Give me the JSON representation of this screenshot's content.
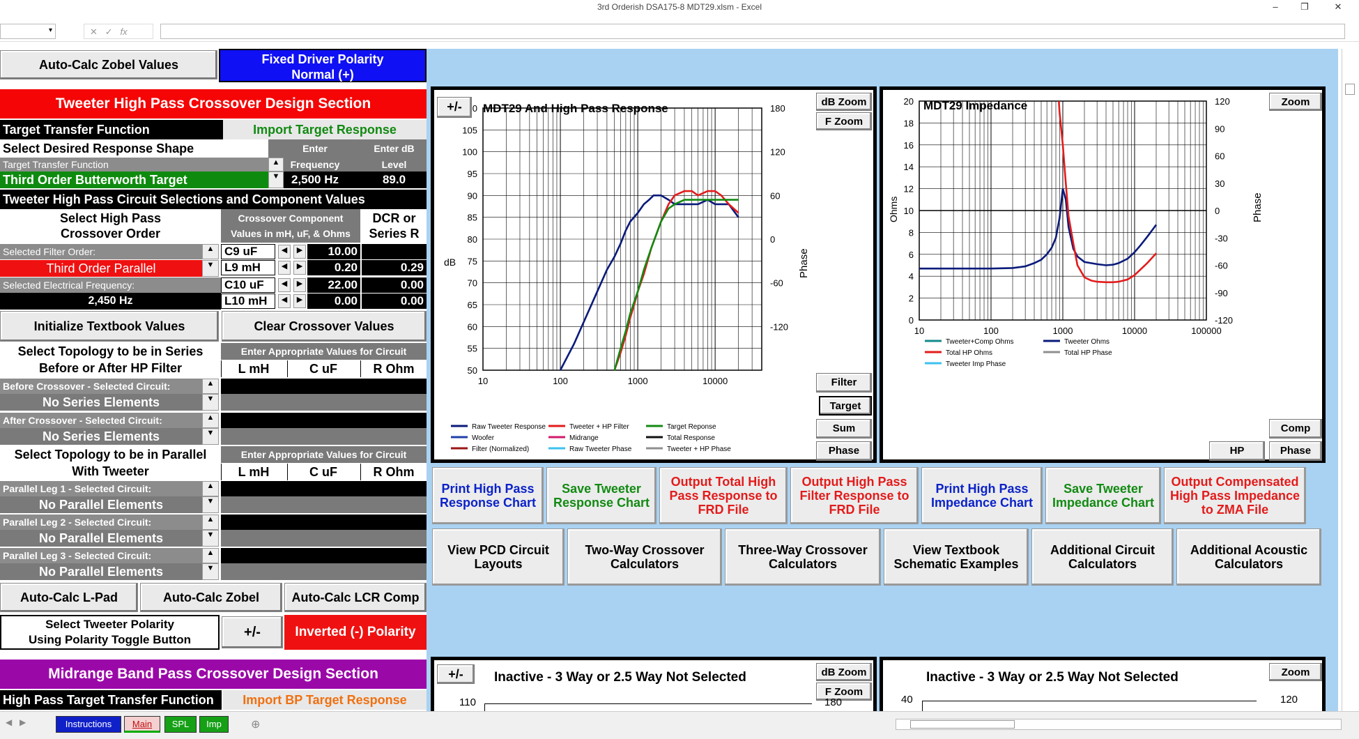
{
  "window": {
    "title": "3rd Orderish DSA175-8 MDT29.xlsm - Excel",
    "minimize": "–",
    "restore": "❐",
    "close": "✕"
  },
  "formula_bar": {
    "cancel": "✕",
    "enter": "✓",
    "fx": "fx"
  },
  "top_buttons": {
    "zobel": "Auto-Calc Zobel Values",
    "polarity_line1": "Fixed Driver Polarity",
    "polarity_line2": "Normal (+)"
  },
  "tweeter": {
    "section_title": "Tweeter High Pass Crossover Design Section",
    "target_tf_label": "Target Transfer Function",
    "import_target": "Import Target Response",
    "select_shape": "Select Desired Response Shape",
    "enter_freq_1": "Enter",
    "enter_freq_2": "Frequency",
    "enter_db_1": "Enter dB",
    "enter_db_2": "Level",
    "tf_small": "Target Transfer Function",
    "tf_value": "Third Order Butterworth Target",
    "freq_value": "2,500 Hz",
    "db_value": "89.0",
    "circuit_sel": "Tweeter High Pass Circuit Selections and Component Values",
    "select_order_1": "Select High Pass",
    "select_order_2": "Crossover Order",
    "comp_vals_1": "Crossover Component",
    "comp_vals_2": "Values in mH, uF, & Ohms",
    "dcr_1": "DCR or",
    "dcr_2": "Series R",
    "sel_filter_order": "Selected Filter Order:",
    "filter_order_value": "Third Order Parallel",
    "sel_elec_freq": "Selected Electrical Frequency:",
    "elec_freq_value": "2,450 Hz",
    "components": [
      {
        "name": "C9  uF",
        "value": "10.00",
        "dcr": ""
      },
      {
        "name": "L9 mH",
        "value": "0.20",
        "dcr": "0.29"
      },
      {
        "name": "C10  uF",
        "value": "22.00",
        "dcr": "0.00"
      },
      {
        "name": "L10 mH",
        "value": "0.00",
        "dcr": "0.00"
      }
    ],
    "init_textbook": "Initialize Textbook Values",
    "clear_values": "Clear Crossover Values",
    "series_title_1": "Select Topology to be in Series",
    "series_title_2": "Before or After HP Filter",
    "enter_vals": "Enter Appropriate Values for Circuit",
    "col_l": "L mH",
    "col_c": "C uF",
    "col_r": "R Ohm",
    "before_label": "Before Crossover - Selected Circuit:",
    "before_value": "No Series Elements",
    "after_label": "After Crossover - Selected Circuit:",
    "after_value": "No Series Elements",
    "parallel_title_1": "Select Topology to be in Parallel",
    "parallel_title_2": "With Tweeter",
    "legs": [
      {
        "label": "Parallel Leg 1 - Selected Circuit:",
        "value": "No Parallel Elements"
      },
      {
        "label": "Parallel Leg 2 - Selected Circuit:",
        "value": "No Parallel Elements"
      },
      {
        "label": "Parallel Leg 3 - Selected Circuit:",
        "value": "No Parallel Elements"
      }
    ],
    "lpad": "Auto-Calc L-Pad",
    "zobel": "Auto-Calc Zobel",
    "lcr": "Auto-Calc LCR Comp",
    "polarity_sel_1": "Select Tweeter Polarity",
    "polarity_sel_2": "Using Polarity Toggle Button",
    "pm_button": "+/-",
    "polarity_value": "Inverted (-) Polarity"
  },
  "midrange": {
    "section_title": "Midrange Band Pass Crossover Design Section",
    "hp_target": "High Pass Target Transfer Function",
    "import_bp": "Import BP Target Response"
  },
  "response_chart": {
    "title": "MDT29  And High Pass Response",
    "pm": "+/-",
    "db_zoom": "dB Zoom",
    "f_zoom": "F Zoom",
    "filter": "Filter",
    "target": "Target",
    "sum": "Sum",
    "phase": "Phase",
    "ylabel": "dB",
    "y2label": "Phase",
    "yticks": [
      "110",
      "105",
      "100",
      "95",
      "90",
      "85",
      "80",
      "75",
      "70",
      "65",
      "60",
      "55",
      "50"
    ],
    "y2ticks": [
      "180",
      "120",
      "60",
      "0",
      "-60",
      "-120"
    ],
    "xticks": [
      "10",
      "100",
      "1000",
      "10000"
    ],
    "legend": [
      {
        "name": "Raw Tweeter Response",
        "color": "#0a1a7a"
      },
      {
        "name": "Tweeter + HP Filter",
        "color": "#e31b1b"
      },
      {
        "name": "Target Reponse",
        "color": "#128a12"
      },
      {
        "name": "Woofer",
        "color": "#1f3fa8"
      },
      {
        "name": "Midrange",
        "color": "#d01a6a"
      },
      {
        "name": "Total Response",
        "color": "#111111"
      },
      {
        "name": "Filter (Normalized)",
        "color": "#9b1616"
      },
      {
        "name": "Raw Tweeter Phase",
        "color": "#3ec1ee"
      },
      {
        "name": "Tweeter + HP Phase",
        "color": "#8f8f8f"
      }
    ]
  },
  "impedance_chart": {
    "title": "MDT29  Impedance",
    "zoom": "Zoom",
    "comp": "Comp",
    "hp": "HP",
    "phase": "Phase",
    "ylabel": "Ohms",
    "y2label": "Phase",
    "yticks": [
      "20",
      "18",
      "16",
      "14",
      "12",
      "10",
      "8",
      "6",
      "4",
      "2",
      "0"
    ],
    "y2ticks": [
      "120",
      "90",
      "60",
      "30",
      "0",
      "-30",
      "-60",
      "-90",
      "-120"
    ],
    "xticks": [
      "10",
      "100",
      "1000",
      "10000",
      "100000"
    ],
    "legend": [
      {
        "name": "Tweeter+Comp Ohms",
        "color": "#138a8a"
      },
      {
        "name": "Tweeter Ohms",
        "color": "#0a1a7a"
      },
      {
        "name": "Total HP Ohms",
        "color": "#e31b1b"
      },
      {
        "name": "Total HP Phase",
        "color": "#8f8f8f"
      },
      {
        "name": "Tweeter Imp Phase",
        "color": "#3ec1ee"
      }
    ]
  },
  "action_row1": [
    {
      "text": "Print High Pass Response Chart",
      "color": "#0b22c9"
    },
    {
      "text": "Save Tweeter Response Chart",
      "color": "#128a12"
    },
    {
      "text": "Output Total High Pass Response to FRD File",
      "color": "#e31b1b"
    },
    {
      "text": "Output High Pass Filter Response to FRD File",
      "color": "#e31b1b"
    },
    {
      "text": "Print High Pass Impedance Chart",
      "color": "#0b22c9"
    },
    {
      "text": "Save Tweeter Impedance Chart",
      "color": "#128a12"
    },
    {
      "text": "Output Compensated High Pass Impedance to ZMA File",
      "color": "#e31b1b"
    }
  ],
  "action_row2": [
    "View PCD Circuit Layouts",
    "Two-Way Crossover Calculators",
    "Three-Way Crossover Calculators",
    "View Textbook Schematic Examples",
    "Additional Circuit Calculators",
    "Additional Acoustic Calculators"
  ],
  "inactive_charts": {
    "title": "Inactive - 3 Way or 2.5 Way Not Selected",
    "pm": "+/-",
    "db_zoom": "dB Zoom",
    "f_zoom": "F Zoom",
    "zoom": "Zoom",
    "y1": "110",
    "y1b": "180",
    "y2": "40",
    "y2b": "120"
  },
  "sheet_tabs": [
    {
      "name": "Instructions",
      "bg": "#1020c8",
      "fg": "#ffffff"
    },
    {
      "name": "Main",
      "bg": "#f4d0d0",
      "fg": "#c01010"
    },
    {
      "name": "SPL",
      "bg": "#16a016",
      "fg": "#ffffff"
    },
    {
      "name": "Imp",
      "bg": "#16a016",
      "fg": "#ffffff"
    }
  ],
  "chart_data": [
    {
      "type": "line",
      "title": "MDT29  And High Pass Response",
      "xscale": "log",
      "xlim": [
        10,
        100000
      ],
      "ylim": [
        50,
        110
      ],
      "y2lim": [
        -180,
        180
      ],
      "series": [
        {
          "name": "Raw Tweeter Response",
          "color": "#0a1a7a",
          "x": [
            100,
            150,
            200,
            300,
            400,
            500,
            600,
            700,
            800,
            1000,
            1200,
            1400,
            1600,
            2000,
            2500,
            3000,
            4000,
            5000,
            6000,
            8000,
            10000,
            12000,
            15000,
            20000
          ],
          "y": [
            50,
            56,
            61,
            68,
            73,
            76,
            79,
            82,
            84,
            86,
            88,
            89,
            90,
            90,
            89,
            88,
            88,
            88,
            88,
            89,
            88,
            88,
            88,
            85
          ]
        },
        {
          "name": "Tweeter + HP Filter",
          "color": "#e31b1b",
          "x": [
            500,
            600,
            700,
            800,
            900,
            1000,
            1200,
            1500,
            2000,
            2500,
            3000,
            4000,
            5000,
            6000,
            8000,
            10000,
            12000,
            15000,
            20000
          ],
          "y": [
            50,
            54,
            58,
            62,
            65,
            68,
            72,
            78,
            84,
            88,
            90,
            91,
            91,
            90,
            91,
            91,
            90,
            88,
            86
          ]
        },
        {
          "name": "Target Reponse",
          "color": "#128a12",
          "x": [
            500,
            600,
            700,
            800,
            1000,
            1200,
            1500,
            2000,
            2500,
            3000,
            4000,
            5000,
            6000,
            8000,
            10000,
            15000,
            20000
          ],
          "y": [
            50,
            55,
            59,
            63,
            68,
            73,
            78,
            84,
            87,
            88,
            89,
            89,
            89,
            89,
            89,
            89,
            89
          ]
        }
      ]
    },
    {
      "type": "line",
      "title": "MDT29  Impedance",
      "xscale": "log",
      "xlim": [
        10,
        100000
      ],
      "ylim": [
        0,
        20
      ],
      "y2lim": [
        -120,
        120
      ],
      "series": [
        {
          "name": "Tweeter Ohms",
          "color": "#0a1a7a",
          "x": [
            10,
            50,
            100,
            200,
            300,
            400,
            500,
            600,
            700,
            800,
            900,
            1000,
            1100,
            1200,
            1400,
            1600,
            2000,
            3000,
            4000,
            5000,
            6000,
            8000,
            10000,
            12000,
            15000,
            20000
          ],
          "y": [
            4.7,
            4.7,
            4.7,
            4.75,
            4.9,
            5.2,
            5.5,
            6.0,
            6.6,
            7.5,
            9.3,
            12.0,
            11.0,
            8.5,
            6.5,
            5.8,
            5.3,
            5.1,
            5.0,
            5.05,
            5.2,
            5.6,
            6.2,
            6.8,
            7.6,
            8.7
          ]
        },
        {
          "name": "Total HP Ohms",
          "color": "#e31b1b",
          "x": [
            880,
            900,
            1000,
            1100,
            1200,
            1400,
            1600,
            2000,
            2500,
            3000,
            4000,
            5000,
            6000,
            8000,
            10000,
            12000,
            15000,
            20000
          ],
          "y": [
            20,
            19,
            16,
            12.5,
            9.5,
            7,
            5,
            3.9,
            3.6,
            3.5,
            3.45,
            3.45,
            3.5,
            3.7,
            4.1,
            4.6,
            5.2,
            6.1
          ]
        }
      ]
    }
  ]
}
